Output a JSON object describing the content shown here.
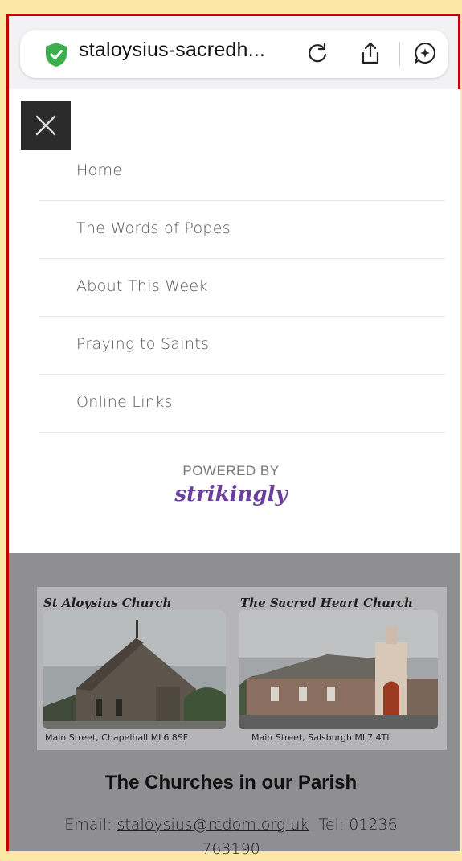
{
  "browser": {
    "url_display": "staloysius-sacredh...",
    "icons": [
      "shield-check-icon",
      "reload-icon",
      "share-icon",
      "assistant-icon"
    ]
  },
  "menu": {
    "close_icon": "close-icon",
    "items": [
      {
        "label": "Home"
      },
      {
        "label": "The Words of Popes"
      },
      {
        "label": "About This Week"
      },
      {
        "label": "Praying to Saints"
      },
      {
        "label": "Online Links"
      }
    ],
    "powered_by": "POWERED BY",
    "brand": "strikingly"
  },
  "footer": {
    "churches": [
      {
        "name": "St Aloysius Church",
        "caption": "Main Street, Chapelhall ML6 8SF"
      },
      {
        "name": "The Sacred Heart Church",
        "caption": "Main Street, Salsburgh ML7 4TL"
      }
    ],
    "heading": "The Churches in our Parish",
    "email_label": "Email:",
    "email": "staloysius@rcdom.org.uk",
    "tel_label": "Tel: 01236",
    "tel_rest": "763190"
  },
  "colors": {
    "frame_border": "#c40000",
    "background_strip": "#fde7a6",
    "brand_purple": "#6a3fa0",
    "shield_green": "#3cae4e",
    "footer_gray": "#8f8f91"
  }
}
